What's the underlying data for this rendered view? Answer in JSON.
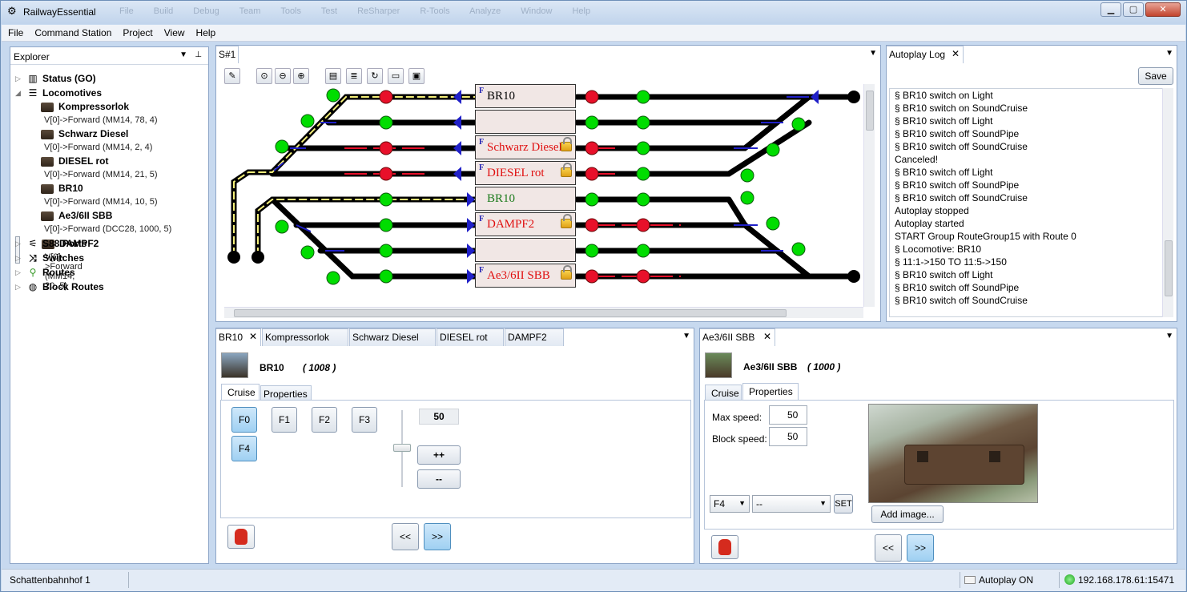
{
  "window": {
    "title": "RailwayEssential",
    "ghost_menu": "File Build Debug Team Tools Test ReSharper R-Tools Analyze Window Help",
    "controls": [
      "▁",
      "▢",
      "✕"
    ]
  },
  "menu": [
    "File",
    "Command Station",
    "Project",
    "View",
    "Help"
  ],
  "explorer": {
    "title": "Explorer",
    "nodes": [
      {
        "label": "Status (GO)",
        "icon": "status-chart-icon"
      },
      {
        "label": "Locomotives",
        "icon": "list-icon"
      }
    ],
    "locomotives": [
      {
        "name": "Kompressorlok",
        "info": "V[0]->Forward (MM14, 78, 4)"
      },
      {
        "name": "Schwarz Diesel",
        "info": "V[0]->Forward (MM14, 2, 4)"
      },
      {
        "name": "DIESEL rot",
        "info": "V[0]->Forward (MM14, 21, 5)"
      },
      {
        "name": "BR10",
        "info": "V[0]->Forward (MM14, 10, 5)"
      },
      {
        "name": "Ae3/6II SBB",
        "info": "V[0]->Forward (DCC28, 1000, 5)"
      },
      {
        "name": "DAMPF2",
        "info": "V[0]->Forward (MM14, 20, 5)"
      }
    ],
    "other_nodes": [
      {
        "label": "S88 Ports",
        "icon": "s88-icon"
      },
      {
        "label": "Switches",
        "icon": "switch-icon"
      },
      {
        "label": "Routes",
        "icon": "route-pin-icon"
      },
      {
        "label": "Block Routes",
        "icon": "globe-icon"
      }
    ]
  },
  "track": {
    "tab": "S#1",
    "blocks": [
      {
        "label": "BR10",
        "f": "F",
        "color": "#000000",
        "lock": false
      },
      {
        "label": "",
        "f": "",
        "color": "#000000",
        "lock": false
      },
      {
        "label": "Schwarz Diesel",
        "f": "F",
        "color": "#e01010",
        "lock": true
      },
      {
        "label": "DIESEL rot",
        "f": "F",
        "color": "#e01010",
        "lock": true
      },
      {
        "label": "BR10",
        "f": "",
        "color": "#1a7a1a",
        "lock": false
      },
      {
        "label": "DAMPF2",
        "f": "F",
        "color": "#e01010",
        "lock": true
      },
      {
        "label": "",
        "f": "",
        "color": "#000000",
        "lock": false
      },
      {
        "label": "Ae3/6II SBB",
        "f": "F",
        "color": "#e01010",
        "lock": true
      }
    ]
  },
  "log": {
    "tab": "Autoplay Log",
    "save": "Save",
    "lines": [
      "§  BR10 switch on Light",
      "§  BR10 switch on SoundCruise",
      "§  BR10 switch off Light",
      "§  BR10 switch off SoundPipe",
      "§  BR10 switch off SoundCruise",
      "Canceled!",
      "§  BR10 switch off Light",
      "§  BR10 switch off SoundPipe",
      "§  BR10 switch off SoundCruise",
      "Autoplay stopped",
      "Autoplay started",
      "START Group RouteGroup15 with Route 0",
      "§  Locomotive: BR10",
      "§  11:1->150  TO  11:5->150",
      "§  BR10 switch off Light",
      "§  BR10 switch off SoundPipe",
      "§  BR10 switch off SoundCruise"
    ]
  },
  "loco_left": {
    "tabs": [
      "BR10",
      "Kompressorlok",
      "Schwarz Diesel",
      "DIESEL rot",
      "DAMPF2"
    ],
    "name": "BR10",
    "address": "(  1008  )",
    "subtabs": [
      "Cruise",
      "Properties"
    ],
    "functions": [
      "F0",
      "F1",
      "F2",
      "F3",
      "F4"
    ],
    "speed": "50",
    "plus": "++",
    "minus": "--",
    "back": "<<",
    "forward": ">>"
  },
  "loco_right": {
    "tab": "Ae3/6II SBB",
    "name": "Ae3/6II SBB",
    "address": "(  1000  )",
    "subtabs": [
      "Cruise",
      "Properties"
    ],
    "max_speed_label": "Max speed:",
    "max_speed": "50",
    "block_speed_label": "Block speed:",
    "block_speed": "50",
    "func_select": "F4",
    "func_value": "--",
    "set": "SET",
    "add_image": "Add image...",
    "back": "<<",
    "forward": ">>"
  },
  "status": {
    "left": "Schattenbahnhof 1",
    "autoplay": "Autoplay ON",
    "ip": "192.168.178.61:15471"
  },
  "colors": {
    "track": "#000000",
    "signal_green": "#00dd00",
    "signal_red": "#e8102a",
    "direction": "#2020c8",
    "route_yellow": "#f5f07a"
  }
}
